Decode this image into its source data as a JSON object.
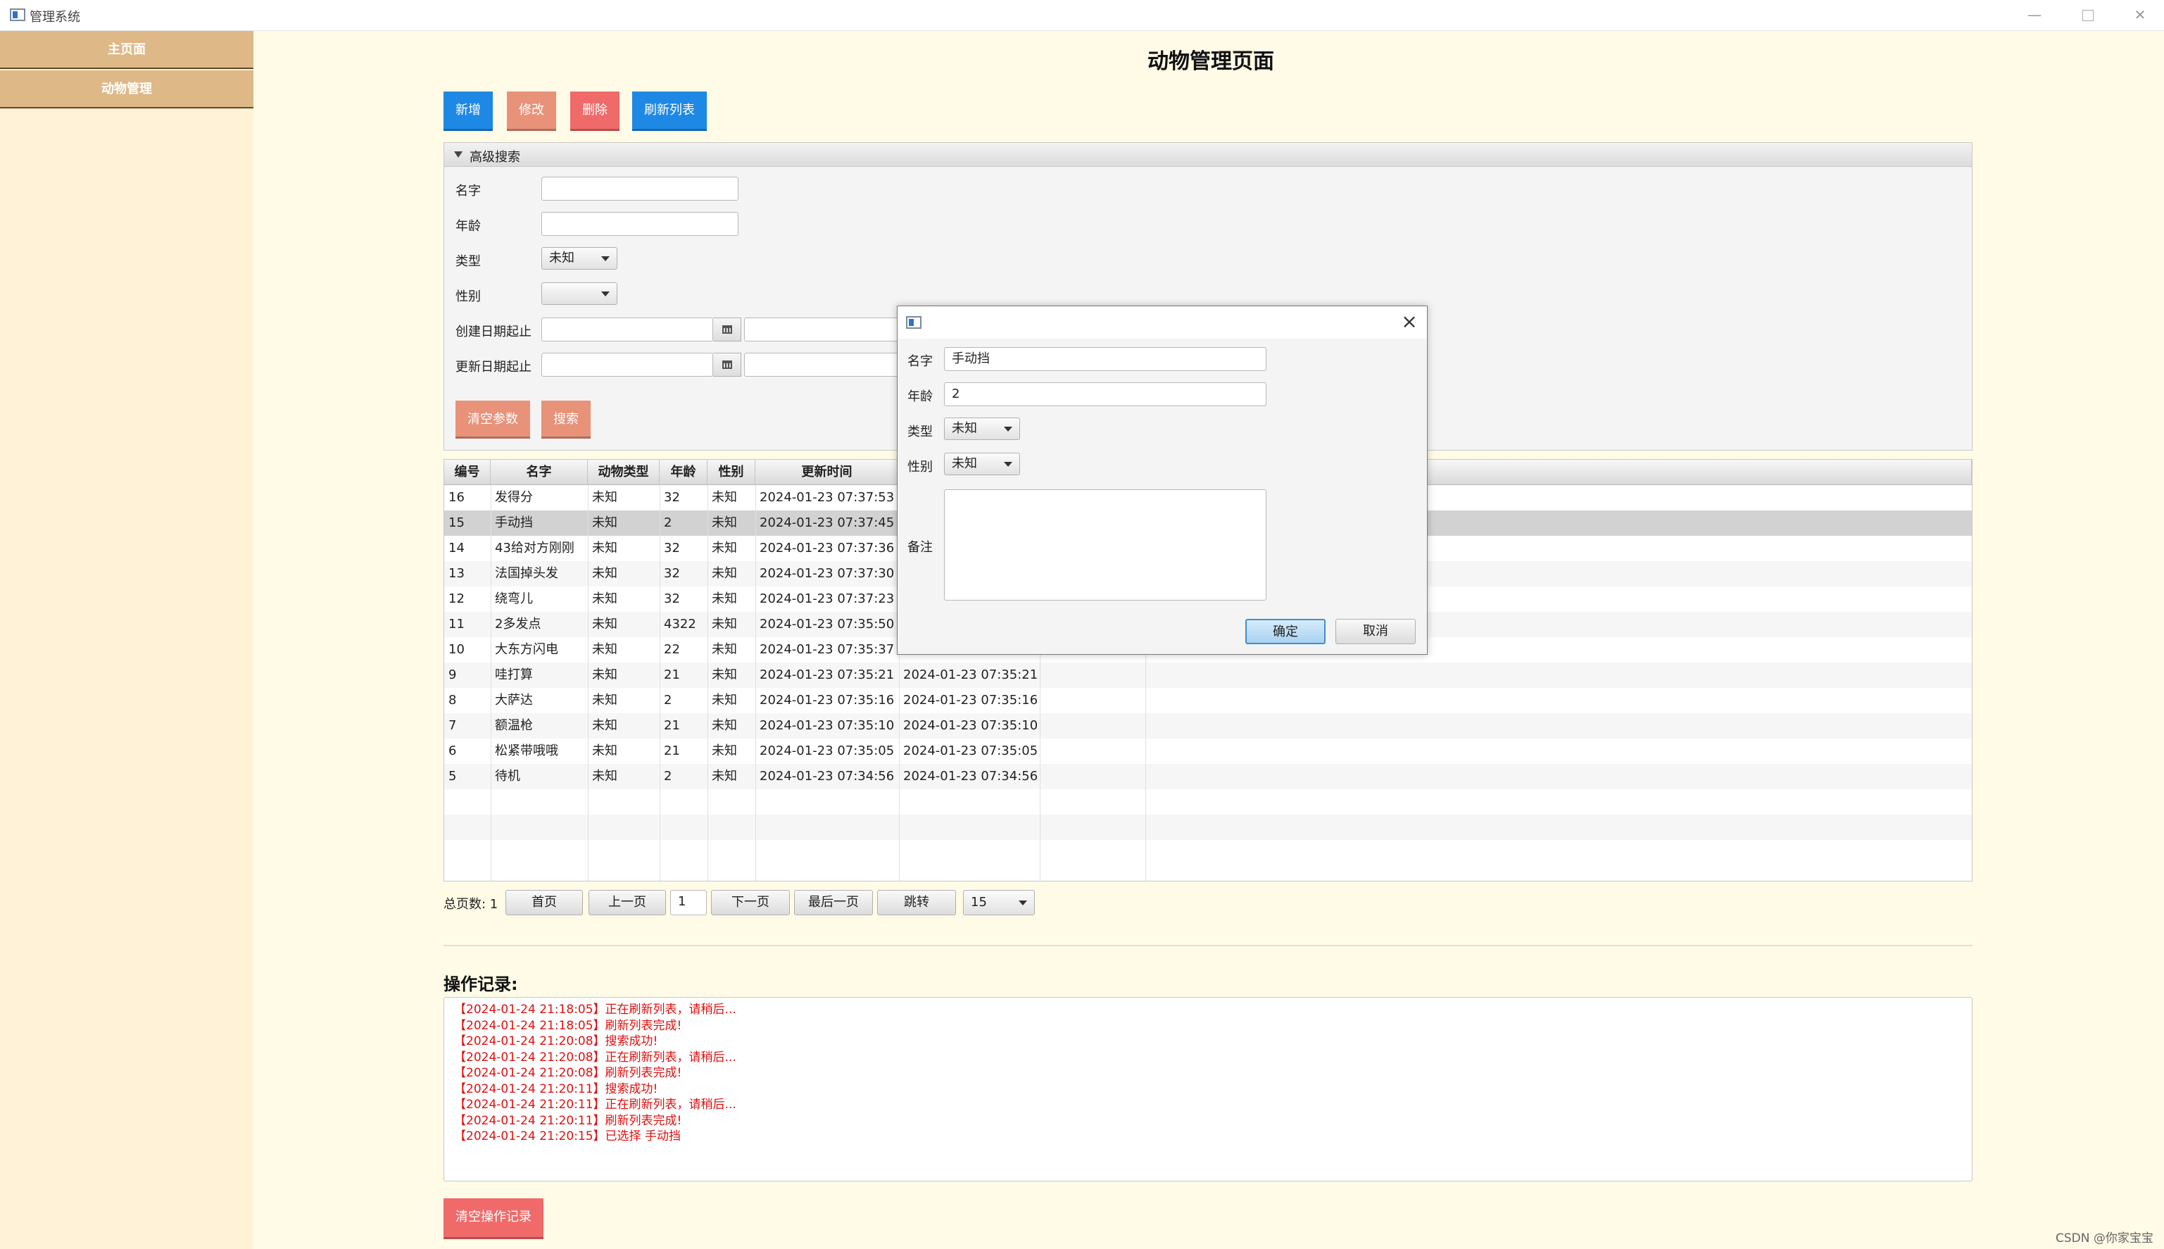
{
  "window": {
    "title": "管理系统"
  },
  "sidebar": {
    "items": [
      {
        "label": "主页面"
      },
      {
        "label": "动物管理"
      }
    ]
  },
  "page": {
    "title": "动物管理页面"
  },
  "toolbar": {
    "add_label": "新增",
    "edit_label": "修改",
    "delete_label": "删除",
    "refresh_label": "刷新列表",
    "colors": {
      "add": "#1e88e5",
      "edit": "#e8927a",
      "delete": "#f06a6a",
      "refresh": "#1e88e5"
    }
  },
  "search": {
    "title": "高级搜索",
    "name_label": "名字",
    "name_value": "",
    "age_label": "年龄",
    "age_value": "",
    "type_label": "类型",
    "type_value": "未知",
    "gender_label": "性别",
    "gender_value": "",
    "created_label": "创建日期起止",
    "updated_label": "更新日期起止",
    "clear_label": "清空参数",
    "search_label": "搜索"
  },
  "table": {
    "columns": [
      "编号",
      "名字",
      "动物类型",
      "年龄",
      "性别",
      "更新时间"
    ],
    "rows": [
      {
        "id": "16",
        "name": "发得分",
        "type": "未知",
        "age": "32",
        "gender": "未知",
        "updated": "2024-01-23 07:37:53",
        "created": ""
      },
      {
        "id": "15",
        "name": "手动挡",
        "type": "未知",
        "age": "2",
        "gender": "未知",
        "updated": "2024-01-23 07:37:45",
        "created": ""
      },
      {
        "id": "14",
        "name": "43给对方刚刚",
        "type": "未知",
        "age": "32",
        "gender": "未知",
        "updated": "2024-01-23 07:37:36",
        "created": ""
      },
      {
        "id": "13",
        "name": "法国掉头发",
        "type": "未知",
        "age": "32",
        "gender": "未知",
        "updated": "2024-01-23 07:37:30",
        "created": ""
      },
      {
        "id": "12",
        "name": "绕弯儿",
        "type": "未知",
        "age": "32",
        "gender": "未知",
        "updated": "2024-01-23 07:37:23",
        "created": ""
      },
      {
        "id": "11",
        "name": "2多发点",
        "type": "未知",
        "age": "4322",
        "gender": "未知",
        "updated": "2024-01-23 07:35:50",
        "created": ""
      },
      {
        "id": "10",
        "name": "大东方闪电",
        "type": "未知",
        "age": "22",
        "gender": "未知",
        "updated": "2024-01-23 07:35:37",
        "created": ""
      },
      {
        "id": "9",
        "name": "哇打算",
        "type": "未知",
        "age": "21",
        "gender": "未知",
        "updated": "2024-01-23 07:35:21",
        "created": "2024-01-23 07:35:21"
      },
      {
        "id": "8",
        "name": "大萨达",
        "type": "未知",
        "age": "2",
        "gender": "未知",
        "updated": "2024-01-23 07:35:16",
        "created": "2024-01-23 07:35:16"
      },
      {
        "id": "7",
        "name": "额温枪",
        "type": "未知",
        "age": "21",
        "gender": "未知",
        "updated": "2024-01-23 07:35:10",
        "created": "2024-01-23 07:35:10"
      },
      {
        "id": "6",
        "name": "松紧带哦哦",
        "type": "未知",
        "age": "21",
        "gender": "未知",
        "updated": "2024-01-23 07:35:05",
        "created": "2024-01-23 07:35:05"
      },
      {
        "id": "5",
        "name": "待机",
        "type": "未知",
        "age": "2",
        "gender": "未知",
        "updated": "2024-01-23 07:34:56",
        "created": "2024-01-23 07:34:56"
      }
    ],
    "selected_id": "15"
  },
  "pagination": {
    "total_label": "总页数: 1",
    "first_label": "首页",
    "prev_label": "上一页",
    "page_value": "1",
    "next_label": "下一页",
    "last_label": "最后一页",
    "jump_label": "跳转",
    "page_size": "15"
  },
  "log": {
    "title": "操作记录:",
    "lines": [
      "【2024-01-24 21:18:05】正在刷新列表，请稍后...",
      "【2024-01-24 21:18:05】刷新列表完成!",
      "【2024-01-24 21:20:08】搜索成功!",
      "【2024-01-24 21:20:08】正在刷新列表，请稍后...",
      "【2024-01-24 21:20:08】刷新列表完成!",
      "【2024-01-24 21:20:11】搜索成功!",
      "【2024-01-24 21:20:11】正在刷新列表，请稍后...",
      "【2024-01-24 21:20:11】刷新列表完成!",
      "【2024-01-24 21:20:15】已选择 手动挡"
    ],
    "clear_label": "清空操作记录",
    "clear_color": "#f06a6a",
    "text_color": "#e01010"
  },
  "dialog": {
    "name_label": "名字",
    "name_value": "手动挡",
    "age_label": "年龄",
    "age_value": "2",
    "type_label": "类型",
    "type_value": "未知",
    "gender_label": "性别",
    "gender_value": "未知",
    "remark_label": "备注",
    "ok_label": "确定",
    "cancel_label": "取消"
  },
  "watermark": "CSDN @你家宝宝"
}
